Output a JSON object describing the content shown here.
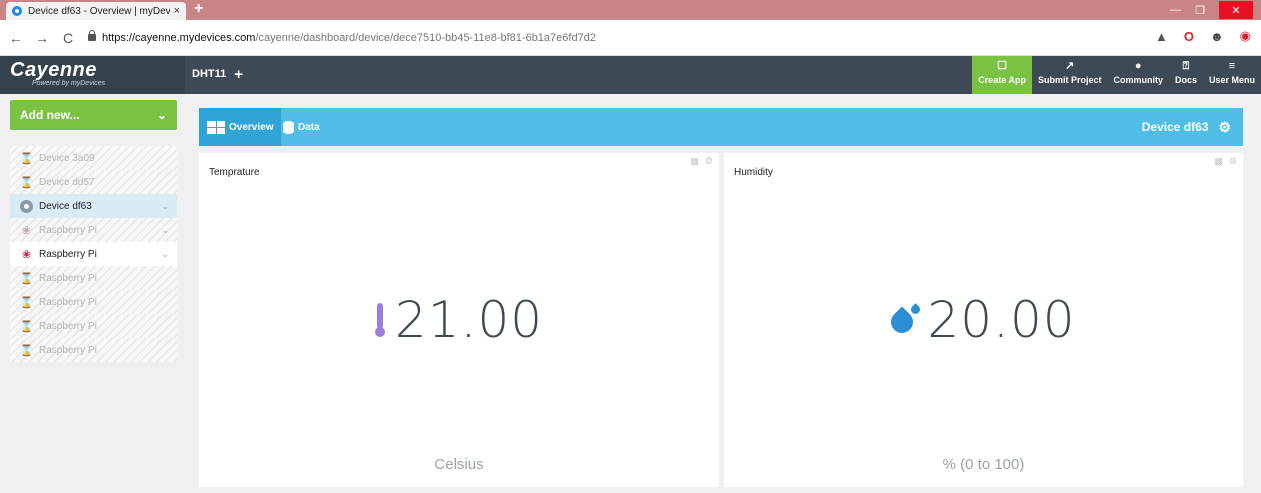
{
  "browser": {
    "tab_title": "Device df63 - Overview | myDevi…",
    "tab_close": "×",
    "new_tab": "+",
    "url_host": "https://cayenne.mydevices.com",
    "url_path": "/cayenne/dashboard/device/dece7510-bb45-11e8-bf81-6b1a7e6fd7d2",
    "back": "←",
    "forward": "→",
    "reload": "C"
  },
  "app": {
    "logo": "Cayenne",
    "logo_sub": "Powered by myDevices",
    "project_tab": "DHT11",
    "project_add": "+",
    "nav": [
      {
        "label": "Create App",
        "icon": "☐"
      },
      {
        "label": "Submit Project",
        "icon": "↗"
      },
      {
        "label": "Community",
        "icon": "●"
      },
      {
        "label": "Docs",
        "icon": "⍰"
      },
      {
        "label": "User Menu",
        "icon": "≡"
      }
    ]
  },
  "sidebar": {
    "add_new": "Add new...",
    "add_new_chevron": "⌄",
    "devices": [
      {
        "label": "Device 3a09",
        "icon": "hourglass-icon",
        "state": "offline"
      },
      {
        "label": "Device dd57",
        "icon": "hourglass-icon",
        "state": "offline"
      },
      {
        "label": "Device df63",
        "icon": "cayenne-icon",
        "state": "selected"
      },
      {
        "label": "Raspberry Pi",
        "icon": "raspberry-icon",
        "state": "offline"
      },
      {
        "label": "Raspberry Pi",
        "icon": "raspberry-icon",
        "state": "online"
      },
      {
        "label": "Raspberry Pi",
        "icon": "hourglass-icon",
        "state": "offline"
      },
      {
        "label": "Raspberry Pi",
        "icon": "hourglass-icon",
        "state": "offline"
      },
      {
        "label": "Raspberry Pi",
        "icon": "hourglass-icon",
        "state": "offline"
      },
      {
        "label": "Raspberry Pi",
        "icon": "hourglass-icon",
        "state": "offline"
      }
    ]
  },
  "dashboard": {
    "tab_overview": "Overview",
    "tab_data": "Data",
    "device_name": "Device df63",
    "widgets": [
      {
        "title": "Temprature",
        "value": "21.00",
        "unit": "Celsius",
        "icon": "thermometer-icon",
        "color": "#9b7fd9"
      },
      {
        "title": "Humidity",
        "value": "20.00",
        "unit": "% (0 to 100)",
        "icon": "water-drop-icon",
        "color": "#2a8fd6"
      }
    ]
  },
  "colors": {
    "accent_green": "#7cc242",
    "header_blue": "#4fbde6",
    "topbar": "#3d4a55"
  }
}
